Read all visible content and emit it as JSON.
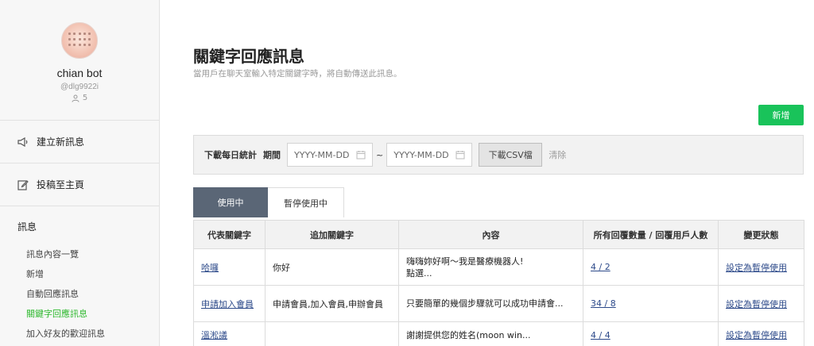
{
  "sidebar": {
    "bot_name": "chian bot",
    "bot_id": "@dlg9922i",
    "friend_count": "5",
    "links": [
      {
        "label": "建立新訊息"
      },
      {
        "label": "投稿至主頁"
      }
    ],
    "section_heading": "訊息",
    "sub_items": [
      {
        "label": "訊息內容一覽"
      },
      {
        "label": "新增"
      },
      {
        "label": "自動回應訊息"
      },
      {
        "label": "關鍵字回應訊息"
      },
      {
        "label": "加入好友的歡迎訊息"
      }
    ]
  },
  "page": {
    "title": "關鍵字回應訊息",
    "subtitle": "當用戶在聊天室輸入特定關鍵字時，將自動傳送此訊息。",
    "add_button": "新增"
  },
  "filter": {
    "label": "下載每日統計",
    "period_label": "期間",
    "start_placeholder": "YYYY-MM-DD",
    "end_placeholder": "YYYY-MM-DD",
    "separator": "~",
    "csv_button": "下載CSV檔",
    "clear": "淸除"
  },
  "tabs": [
    {
      "label": "使用中",
      "active": true
    },
    {
      "label": "暫停使用中",
      "active": false
    }
  ],
  "table": {
    "headers": [
      "代表關鍵字",
      "追加關鍵字",
      "內容",
      "所有回覆數量 / 回覆用戶人數",
      "變更狀態"
    ],
    "rows": [
      {
        "keyword": "哈囉",
        "extra": "你好",
        "content_line1": "嗨嗨妳好啊～我是醫療機器人!",
        "content_line2": "點選...",
        "stats": "4 / 2",
        "action": "設定為暫停使用"
      },
      {
        "keyword": "申請加入會員",
        "extra": "申請會員,加入會員,申辦會員",
        "content_line1": "只要簡單的幾個步驟就可以成功申請會...",
        "content_line2": "",
        "stats": "34 / 8",
        "action": "設定為暫停使用"
      },
      {
        "keyword": "溫淞議",
        "extra": "",
        "content_line1": "謝謝提供您的姓名(moon win...",
        "content_line2": "",
        "stats": "4 / 4",
        "action": "設定為暫停使用"
      }
    ]
  },
  "colors": {
    "accent_green": "#19c35a",
    "active_menu_green": "#2eb82e",
    "tab_active_bg": "#5a6676",
    "link_blue": "#2d4a8a"
  }
}
